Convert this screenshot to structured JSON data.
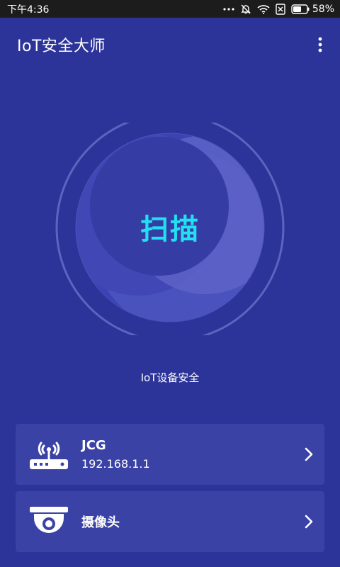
{
  "status_bar": {
    "time": "下午4:36",
    "battery": "58%",
    "icons": [
      "more-dots-icon",
      "mute-icon",
      "wifi-icon",
      "sim-error-icon",
      "battery-icon"
    ]
  },
  "app_bar": {
    "title": "IoT安全大师",
    "menu_icon": "more-vert-icon"
  },
  "scan": {
    "label": "扫描",
    "accent_color": "#22e0f0"
  },
  "subtitle": "IoT设备安全",
  "devices": [
    {
      "name": "JCG",
      "ip": "192.168.1.1",
      "icon": "router-icon"
    },
    {
      "name": "摄像头",
      "icon": "camera-icon"
    }
  ],
  "colors": {
    "background": "#2d3499",
    "card": "#3a42a6",
    "status_bar": "#1c1c1c"
  }
}
